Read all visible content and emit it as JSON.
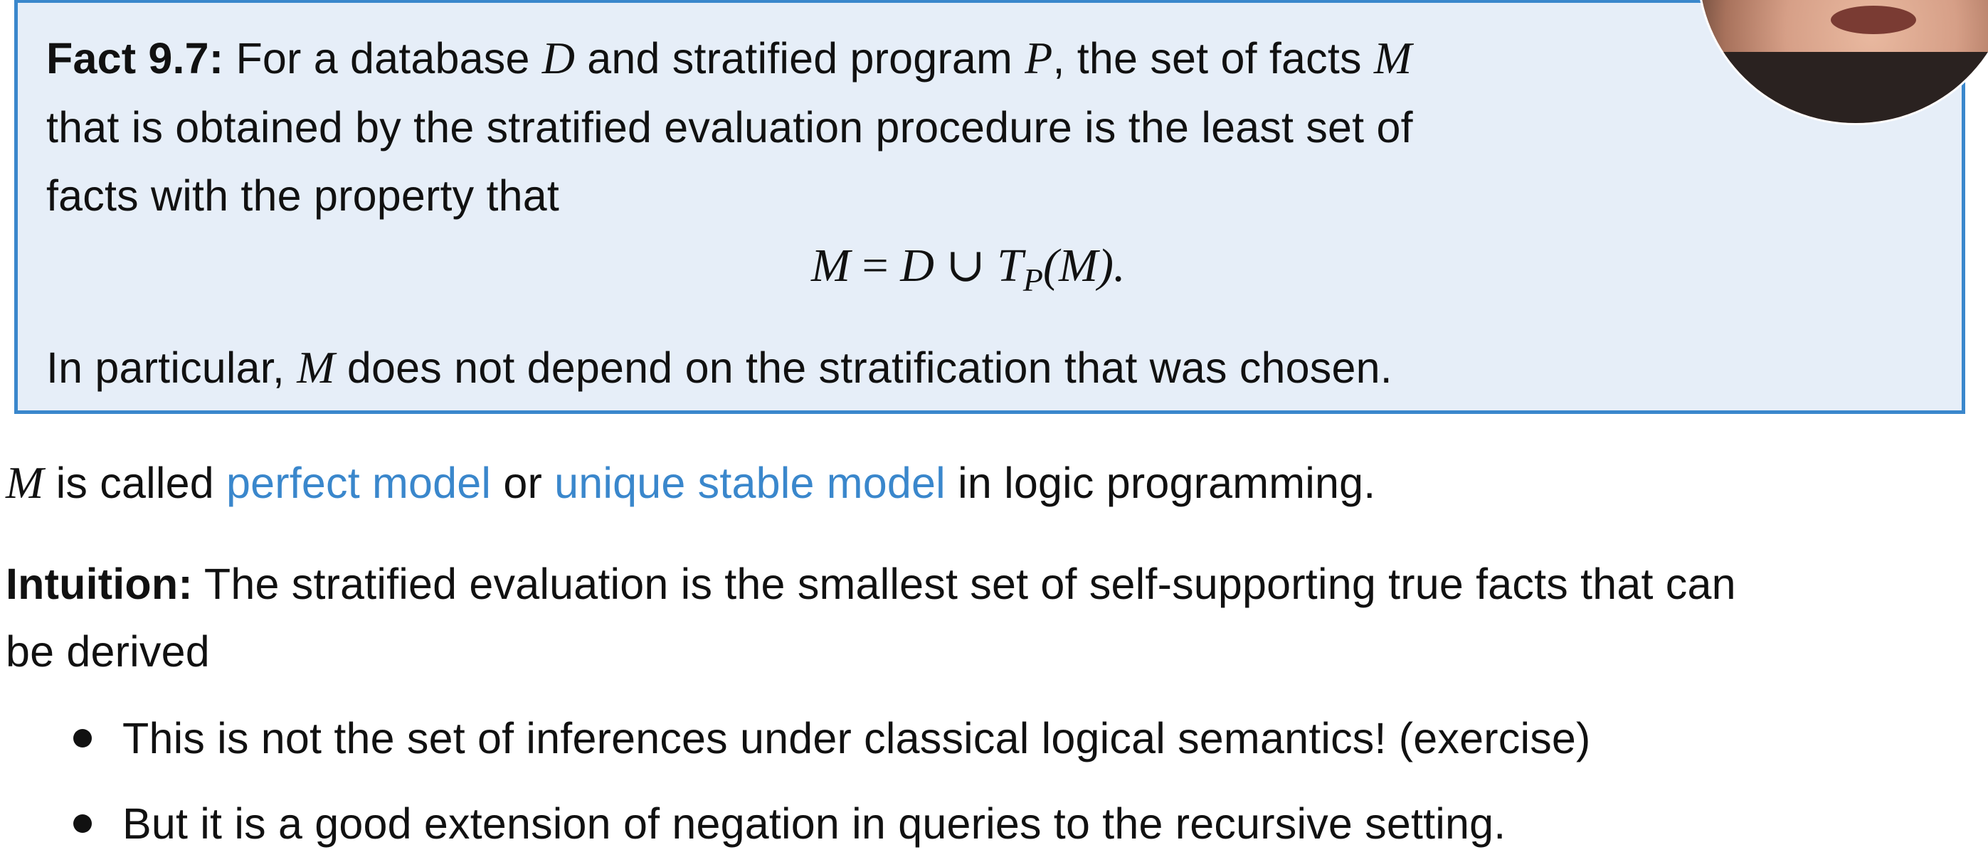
{
  "fact": {
    "label": "Fact 9.7:",
    "line1_a": " For a database ",
    "var_D": "D",
    "line1_b": " and stratified program ",
    "var_P": "P",
    "line1_c": ", the set of facts ",
    "var_M": "M",
    "line2": "that is obtained by the stratified evaluation procedure is the least set of",
    "line3": "facts with the property that",
    "equation": {
      "lhs": "M",
      "eq": " = ",
      "D": "D",
      "cup": " ∪ ",
      "T": "T",
      "sub": "P",
      "arg": "(M)."
    },
    "line4_a": "In particular, ",
    "line4_var": "M",
    "line4_b": " does not depend on the stratification that was chosen."
  },
  "perfect": {
    "var": "M",
    "text_a": " is called ",
    "link1": "perfect model",
    "text_b": " or ",
    "link2": "unique stable model",
    "text_c": " in logic programming."
  },
  "intuition": {
    "label": "Intuition:",
    "line1": " The stratified evaluation is the smallest set of self-supporting true facts that can",
    "line2": "be derived"
  },
  "bullets": [
    "This is not the set of inferences under classical logical semantics! (exercise)",
    "But it is a good extension of negation in queries to the recursive setting."
  ],
  "colors": {
    "accent": "#3a87cc",
    "box_background": "#e6eef8",
    "text": "#111111"
  }
}
